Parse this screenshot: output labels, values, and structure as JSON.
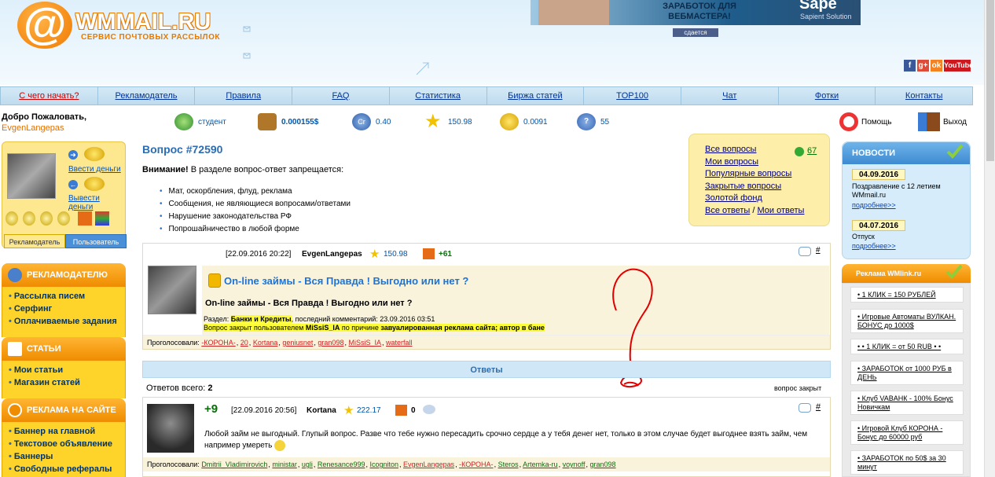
{
  "header": {
    "logo_at": "@",
    "logo_text": "WMMAIL.RU",
    "logo_subtitle": "СЕРВИС ПОЧТОВЫХ РАССЫЛОК",
    "banner_text": "ЗАРАБОТОК ДЛЯ ВЕБМАСТЕРА!",
    "banner_brand": "Sape",
    "banner_brand_sub": "Sapient Solution",
    "banner_label": "сдается",
    "social": [
      {
        "icon": "facebook-icon",
        "label": "f",
        "color": "#3b5998"
      },
      {
        "icon": "google-plus-icon",
        "label": "g+",
        "color": "#dd4b39"
      },
      {
        "icon": "odnoklassniki-icon",
        "label": "ok",
        "color": "#f58220"
      },
      {
        "icon": "youtube-icon",
        "label": "YouTube",
        "color": "#cc181e"
      }
    ]
  },
  "menu": [
    {
      "label": "С чего начать?",
      "color": "#cc0000"
    },
    {
      "label": "Рекламодатель"
    },
    {
      "label": "Правила"
    },
    {
      "label": "FAQ"
    },
    {
      "label": "Статистика"
    },
    {
      "label": "Биржа статей"
    },
    {
      "label": "TOP100"
    },
    {
      "label": "Чат"
    },
    {
      "label": "Фотки"
    },
    {
      "label": "Контакты"
    }
  ],
  "user": {
    "welcome": "Добро Пожаловать,",
    "username": "EvgenLangepas",
    "status": "студент",
    "balance": "0.000155$",
    "credits": "0.40",
    "rating": "150.98",
    "coins": "0.0091",
    "questions": "55",
    "help_label": "Помощь",
    "exit_label": "Выход"
  },
  "profile": {
    "deposit_label": "Ввести деньги",
    "withdraw_label": "Вывести деньги",
    "tab_advertiser": "Рекламодатель",
    "tab_user": "Пользователь"
  },
  "left_sections": [
    {
      "title": "РЕКЛАМОДАТЕЛЮ",
      "items": [
        "Рассылка писем",
        "Серфинг",
        "Оплачиваемые задания"
      ]
    },
    {
      "title": "СТАТЬИ",
      "items": [
        "Мои статьи",
        "Магазин статей"
      ]
    },
    {
      "title": "РЕКЛАМА НА САЙТЕ",
      "items": [
        "Баннер на главной",
        "Текстовое объявление",
        "Баннеры",
        "Свободные рефералы"
      ]
    }
  ],
  "question": {
    "title": "Вопрос #72590",
    "warning_bold": "Внимание!",
    "warning_text": " В разделе вопрос-ответ запрещается:",
    "rules": [
      "Мат, оскорбления, флуд, реклама",
      "Сообщения, не являющиеся вопросами/ответами",
      "Нарушение законодательства РФ",
      "Попрошайничество в любой форме"
    ]
  },
  "qnav": {
    "links": [
      "Все вопросы",
      "Мои вопросы",
      "Популярные вопросы",
      "Закрытые вопросы",
      "Золотой фонд"
    ],
    "last_a": "Все ответы",
    "last_sep": " / ",
    "last_b": "Мои ответы",
    "count": "67"
  },
  "post1": {
    "date": "[22.09.2016 20:22]",
    "author": "EvgenLangepas",
    "rating": "150.98",
    "score": "+61",
    "hash": "#",
    "title": "On-line займы - Вся Правда ! Выгодно или нет ?",
    "subtitle": "On-line займы - Вся Правда ! Выгодно или нет ?",
    "meta_section_label": "Раздел: ",
    "meta_section": "Банки и Кредиты",
    "meta_last": ", последний комментарий: 23.09.2016 03:51",
    "meta_closed_by": "Вопрос закрыт пользователем ",
    "meta_closer": "MiSsiS_IA",
    "meta_reason_label": " по причине ",
    "meta_reason": "завуалированная реклама сайта; автор в бане",
    "voted_label": "Проголосовали: ",
    "voters": [
      "-КОРОНА-",
      "20",
      "Kortana",
      "geniusnet",
      "gran098",
      "MiSsiS_IA",
      "waterfall"
    ]
  },
  "answers": {
    "header": "Ответы",
    "total_label": "Ответов всего: ",
    "total": "2",
    "closed": "вопрос закрыт"
  },
  "post2": {
    "score": "+9",
    "date": "[22.09.2016 20:56]",
    "author": "Kortana",
    "rating": "222.17",
    "coins": "0",
    "hash": "#",
    "text": "Любой займ не выгодный. Глупый вопрос. Разве что тебе нужно пересадить срочно сердце а у тебя денег нет, только в этом случае будет выгоднее взять займ, чем например умереть",
    "voted_label": "Проголосовали: ",
    "voters": [
      "Dmitrii_Vladimirovich",
      "ministar",
      "ugli",
      "Renesance999",
      "Icogniton",
      "EvgenLangepas",
      "-КОРОНА-",
      "Steros",
      "Artemka-ru",
      "voynoff",
      "gran098"
    ]
  },
  "news": {
    "title": "НОВОСТИ",
    "items": [
      {
        "date": "04.09.2016",
        "text": "Поздравление с 12 летием WMmail.ru",
        "more": "подробнее>>"
      },
      {
        "date": "04.07.2016",
        "text": "Отпуск",
        "more": "подробнее>>"
      }
    ]
  },
  "wmlink": {
    "title": "Реклама WMlink.ru",
    "items": [
      "• 1 КЛИК = 150 РУБЛЕЙ",
      "• Игровые Автоматы ВУЛКАН. БОНУС до 1000$",
      "• • 1 КЛИК = от 50 RUB • •",
      "• ЗАРАБОТОК от 1000 РУБ в ДЕНЬ",
      "• Клуб VABAНК - 100% Бонус Новичкам",
      "• Игровой Клуб КОРОНА - Бонус до 60000 руб",
      "• ЗАРАБОТОК по 50$ за 30 минут"
    ]
  }
}
